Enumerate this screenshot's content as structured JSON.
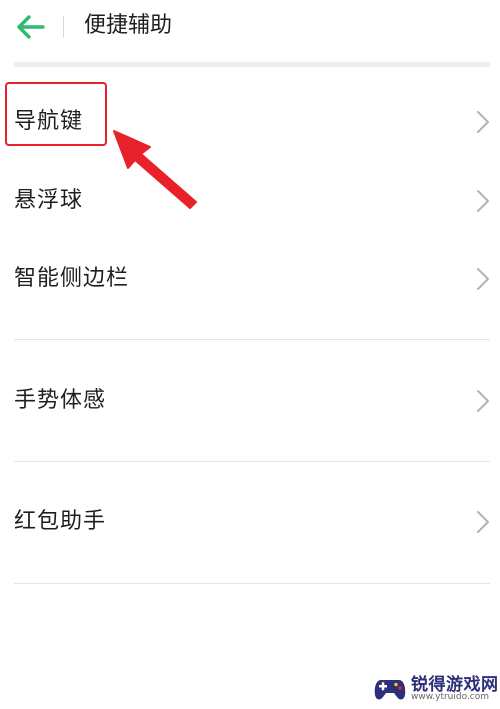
{
  "header": {
    "back_icon": "arrow-left-icon",
    "title": "便捷辅助",
    "accent_color": "#2ebb6b"
  },
  "sections": [
    {
      "items": [
        {
          "label": "导航键",
          "icon": "chevron-right-icon",
          "highlighted": true
        },
        {
          "label": "悬浮球",
          "icon": "chevron-right-icon"
        },
        {
          "label": "智能侧边栏",
          "icon": "chevron-right-icon"
        }
      ]
    },
    {
      "items": [
        {
          "label": "手势体感",
          "icon": "chevron-right-icon"
        }
      ]
    },
    {
      "items": [
        {
          "label": "红包助手",
          "icon": "chevron-right-icon"
        }
      ]
    }
  ],
  "annotation": {
    "highlight_color": "#e8212a",
    "arrow_color": "#e8212a"
  },
  "watermark": {
    "title": "锐得游戏网",
    "url": "www.ytruido.com"
  }
}
